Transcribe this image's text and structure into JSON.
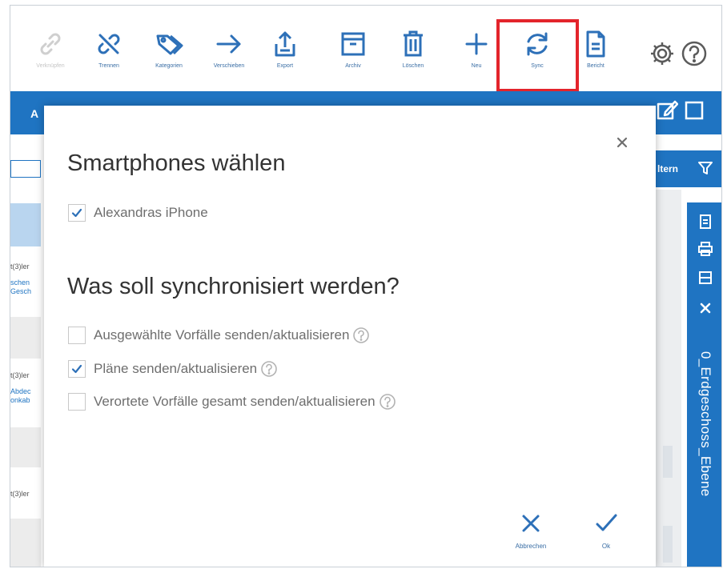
{
  "toolbar": {
    "buttons": [
      {
        "label": "Verknüpfen",
        "icon": "link-icon",
        "disabled": true
      },
      {
        "label": "Trennen",
        "icon": "unlink-icon",
        "disabled": false
      },
      {
        "label": "Kategorien",
        "icon": "tags-icon",
        "disabled": false
      },
      {
        "label": "Verschieben",
        "icon": "arrow-right-icon",
        "disabled": false
      },
      {
        "label": "Export",
        "icon": "export-icon",
        "disabled": false
      },
      {
        "label": "Archiv",
        "icon": "archive-icon",
        "disabled": false
      },
      {
        "label": "Löschen",
        "icon": "trash-icon",
        "disabled": false
      },
      {
        "label": "Neu",
        "icon": "plus-icon",
        "disabled": false
      },
      {
        "label": "Sync",
        "icon": "sync-icon",
        "disabled": false
      },
      {
        "label": "Bericht",
        "icon": "report-icon",
        "disabled": false
      }
    ],
    "highlight_color": "#e3242b"
  },
  "background": {
    "bar_letter": "A",
    "filter_label": "ltern",
    "left_rows": [
      {
        "lines": [
          "t(3)ler"
        ],
        "link": false
      },
      {
        "lines": [
          "schen",
          "Gesch"
        ],
        "link": true
      },
      {
        "lines": [
          "t(3)ler"
        ],
        "link": false
      },
      {
        "lines": [
          "Abdec",
          "onkab"
        ],
        "link": true
      },
      {
        "lines": [
          "t(3)ler"
        ],
        "link": false
      }
    ],
    "panel_title": "0_Erdgeschoss_Ebene",
    "accent_color": "#1f74c2"
  },
  "dialog": {
    "title": "Smartphones wählen",
    "phones": [
      {
        "label": "Alexandras iPhone",
        "checked": true
      }
    ],
    "sync_heading": "Was soll synchronisiert werden?",
    "options": [
      {
        "label": "Ausgewählte Vorfälle senden/aktualisieren",
        "checked": false
      },
      {
        "label": "Pläne senden/aktualisieren",
        "checked": true
      },
      {
        "label": "Verortete Vorfälle gesamt senden/aktualisieren",
        "checked": false
      }
    ],
    "cancel_label": "Abbrechen",
    "ok_label": "Ok"
  }
}
